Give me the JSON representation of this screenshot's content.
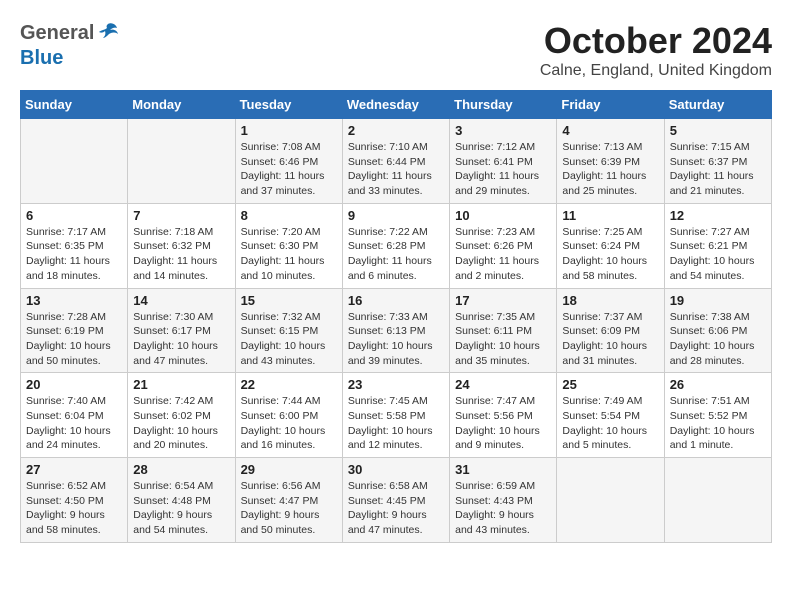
{
  "logo": {
    "general": "General",
    "blue": "Blue"
  },
  "title": "October 2024",
  "location": "Calne, England, United Kingdom",
  "days_of_week": [
    "Sunday",
    "Monday",
    "Tuesday",
    "Wednesday",
    "Thursday",
    "Friday",
    "Saturday"
  ],
  "weeks": [
    [
      {
        "day": "",
        "info": ""
      },
      {
        "day": "",
        "info": ""
      },
      {
        "day": "1",
        "info": "Sunrise: 7:08 AM\nSunset: 6:46 PM\nDaylight: 11 hours\nand 37 minutes."
      },
      {
        "day": "2",
        "info": "Sunrise: 7:10 AM\nSunset: 6:44 PM\nDaylight: 11 hours\nand 33 minutes."
      },
      {
        "day": "3",
        "info": "Sunrise: 7:12 AM\nSunset: 6:41 PM\nDaylight: 11 hours\nand 29 minutes."
      },
      {
        "day": "4",
        "info": "Sunrise: 7:13 AM\nSunset: 6:39 PM\nDaylight: 11 hours\nand 25 minutes."
      },
      {
        "day": "5",
        "info": "Sunrise: 7:15 AM\nSunset: 6:37 PM\nDaylight: 11 hours\nand 21 minutes."
      }
    ],
    [
      {
        "day": "6",
        "info": "Sunrise: 7:17 AM\nSunset: 6:35 PM\nDaylight: 11 hours\nand 18 minutes."
      },
      {
        "day": "7",
        "info": "Sunrise: 7:18 AM\nSunset: 6:32 PM\nDaylight: 11 hours\nand 14 minutes."
      },
      {
        "day": "8",
        "info": "Sunrise: 7:20 AM\nSunset: 6:30 PM\nDaylight: 11 hours\nand 10 minutes."
      },
      {
        "day": "9",
        "info": "Sunrise: 7:22 AM\nSunset: 6:28 PM\nDaylight: 11 hours\nand 6 minutes."
      },
      {
        "day": "10",
        "info": "Sunrise: 7:23 AM\nSunset: 6:26 PM\nDaylight: 11 hours\nand 2 minutes."
      },
      {
        "day": "11",
        "info": "Sunrise: 7:25 AM\nSunset: 6:24 PM\nDaylight: 10 hours\nand 58 minutes."
      },
      {
        "day": "12",
        "info": "Sunrise: 7:27 AM\nSunset: 6:21 PM\nDaylight: 10 hours\nand 54 minutes."
      }
    ],
    [
      {
        "day": "13",
        "info": "Sunrise: 7:28 AM\nSunset: 6:19 PM\nDaylight: 10 hours\nand 50 minutes."
      },
      {
        "day": "14",
        "info": "Sunrise: 7:30 AM\nSunset: 6:17 PM\nDaylight: 10 hours\nand 47 minutes."
      },
      {
        "day": "15",
        "info": "Sunrise: 7:32 AM\nSunset: 6:15 PM\nDaylight: 10 hours\nand 43 minutes."
      },
      {
        "day": "16",
        "info": "Sunrise: 7:33 AM\nSunset: 6:13 PM\nDaylight: 10 hours\nand 39 minutes."
      },
      {
        "day": "17",
        "info": "Sunrise: 7:35 AM\nSunset: 6:11 PM\nDaylight: 10 hours\nand 35 minutes."
      },
      {
        "day": "18",
        "info": "Sunrise: 7:37 AM\nSunset: 6:09 PM\nDaylight: 10 hours\nand 31 minutes."
      },
      {
        "day": "19",
        "info": "Sunrise: 7:38 AM\nSunset: 6:06 PM\nDaylight: 10 hours\nand 28 minutes."
      }
    ],
    [
      {
        "day": "20",
        "info": "Sunrise: 7:40 AM\nSunset: 6:04 PM\nDaylight: 10 hours\nand 24 minutes."
      },
      {
        "day": "21",
        "info": "Sunrise: 7:42 AM\nSunset: 6:02 PM\nDaylight: 10 hours\nand 20 minutes."
      },
      {
        "day": "22",
        "info": "Sunrise: 7:44 AM\nSunset: 6:00 PM\nDaylight: 10 hours\nand 16 minutes."
      },
      {
        "day": "23",
        "info": "Sunrise: 7:45 AM\nSunset: 5:58 PM\nDaylight: 10 hours\nand 12 minutes."
      },
      {
        "day": "24",
        "info": "Sunrise: 7:47 AM\nSunset: 5:56 PM\nDaylight: 10 hours\nand 9 minutes."
      },
      {
        "day": "25",
        "info": "Sunrise: 7:49 AM\nSunset: 5:54 PM\nDaylight: 10 hours\nand 5 minutes."
      },
      {
        "day": "26",
        "info": "Sunrise: 7:51 AM\nSunset: 5:52 PM\nDaylight: 10 hours\nand 1 minute."
      }
    ],
    [
      {
        "day": "27",
        "info": "Sunrise: 6:52 AM\nSunset: 4:50 PM\nDaylight: 9 hours\nand 58 minutes."
      },
      {
        "day": "28",
        "info": "Sunrise: 6:54 AM\nSunset: 4:48 PM\nDaylight: 9 hours\nand 54 minutes."
      },
      {
        "day": "29",
        "info": "Sunrise: 6:56 AM\nSunset: 4:47 PM\nDaylight: 9 hours\nand 50 minutes."
      },
      {
        "day": "30",
        "info": "Sunrise: 6:58 AM\nSunset: 4:45 PM\nDaylight: 9 hours\nand 47 minutes."
      },
      {
        "day": "31",
        "info": "Sunrise: 6:59 AM\nSunset: 4:43 PM\nDaylight: 9 hours\nand 43 minutes."
      },
      {
        "day": "",
        "info": ""
      },
      {
        "day": "",
        "info": ""
      }
    ]
  ]
}
